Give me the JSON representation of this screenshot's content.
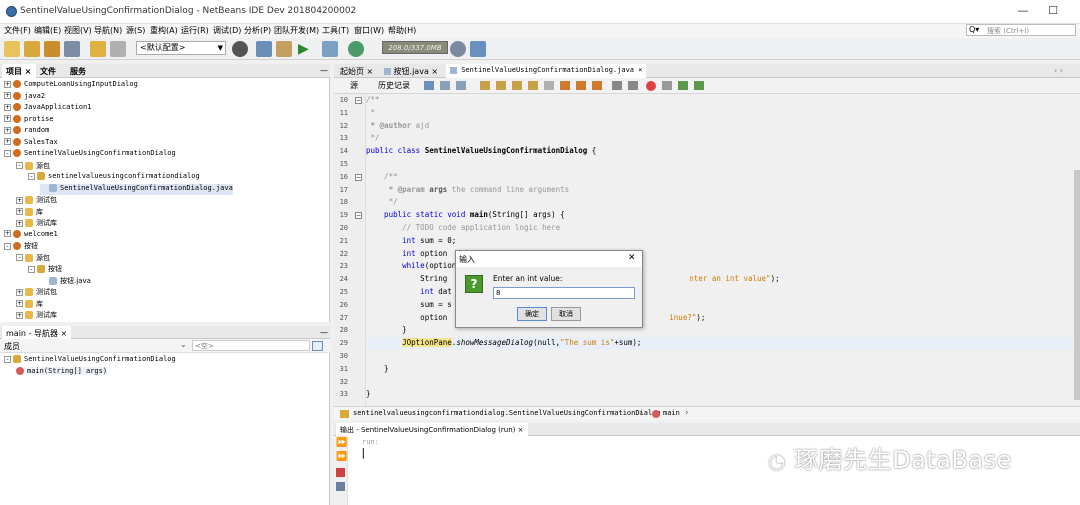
{
  "window": {
    "title": "SentinelValueUsingConfirmationDialog - NetBeans IDE Dev 201804200002",
    "minimize": "—",
    "maximize": "☐"
  },
  "menu": [
    "文件(F)",
    "编辑(E)",
    "视图(V)",
    "导航(N)",
    "源(S)",
    "重构(A)",
    "运行(R)",
    "调试(D)",
    "分析(P)",
    "团队开发(M)",
    "工具(T)",
    "窗口(W)",
    "帮助(H)"
  ],
  "search": {
    "icon": "Q▾",
    "placeholder": "搜索 (Ctrl+I)"
  },
  "toolbar": {
    "config": "<默认配置>",
    "memory": "208.0/337.0MB"
  },
  "project_panel": {
    "tabs": [
      "项目",
      "文件",
      "服务"
    ],
    "close": "×",
    "minimize": "—",
    "tree": [
      {
        "indent": 0,
        "exp": "+",
        "icon": "cup",
        "label": "ComputeLoanUsingInputDialog"
      },
      {
        "indent": 0,
        "exp": "+",
        "icon": "cup",
        "label": "java2"
      },
      {
        "indent": 0,
        "exp": "+",
        "icon": "cup",
        "label": "JavaApplication1"
      },
      {
        "indent": 0,
        "exp": "+",
        "icon": "cup",
        "label": "protise"
      },
      {
        "indent": 0,
        "exp": "+",
        "icon": "cup",
        "label": "random"
      },
      {
        "indent": 0,
        "exp": "+",
        "icon": "cup",
        "label": "SalesTax"
      },
      {
        "indent": 0,
        "exp": "-",
        "icon": "cup",
        "label": "SentinelValueUsingConfirmationDialog"
      },
      {
        "indent": 1,
        "exp": "-",
        "icon": "folder",
        "label": "源包"
      },
      {
        "indent": 2,
        "exp": "-",
        "icon": "pkg",
        "label": "sentinelvalueusingconfirmationdialog"
      },
      {
        "indent": 3,
        "exp": "",
        "icon": "jfile",
        "label": "SentinelValueUsingConfirmationDialog.java",
        "selected": true
      },
      {
        "indent": 1,
        "exp": "+",
        "icon": "folder",
        "label": "测试包"
      },
      {
        "indent": 1,
        "exp": "+",
        "icon": "folder",
        "label": "库"
      },
      {
        "indent": 1,
        "exp": "+",
        "icon": "folder",
        "label": "测试库"
      },
      {
        "indent": 0,
        "exp": "+",
        "icon": "cup",
        "label": "welcome1"
      },
      {
        "indent": 0,
        "exp": "-",
        "icon": "cup",
        "label": "按钮"
      },
      {
        "indent": 1,
        "exp": "-",
        "icon": "folder",
        "label": "源包"
      },
      {
        "indent": 2,
        "exp": "-",
        "icon": "pkg",
        "label": "按钮"
      },
      {
        "indent": 3,
        "exp": "",
        "icon": "jfile",
        "label": "按钮.java"
      },
      {
        "indent": 1,
        "exp": "+",
        "icon": "folder",
        "label": "测试包"
      },
      {
        "indent": 1,
        "exp": "+",
        "icon": "folder",
        "label": "库"
      },
      {
        "indent": 1,
        "exp": "+",
        "icon": "folder",
        "label": "测试库"
      }
    ]
  },
  "navigator": {
    "tab": "main - 导航器",
    "close": "×",
    "minimize": "—",
    "filter_left": "成员",
    "filter_right": "<空>",
    "tree": [
      {
        "indent": 0,
        "exp": "-",
        "label": "SentinelValueUsingConfirmationDialog"
      },
      {
        "indent": 1,
        "exp": "",
        "label": "main(String[] args)"
      }
    ]
  },
  "editor": {
    "tabs": [
      {
        "label": "起始页",
        "active": false
      },
      {
        "label": "按钮.java",
        "active": false
      },
      {
        "label": "SentinelValueUsingConfirmationDialog.java",
        "active": true
      }
    ],
    "close": "×",
    "nav_arrows": "‹ ›",
    "source_tab": "源",
    "history_tab": "历史记录",
    "lines": [
      10,
      11,
      12,
      13,
      14,
      15,
      16,
      17,
      18,
      19,
      20,
      21,
      22,
      23,
      24,
      25,
      26,
      27,
      28,
      29,
      30,
      31,
      32,
      33
    ],
    "breadcrumb": {
      "class": "sentinelvalueusingconfirmationdialog.SentinelValueUsingConfirmationDialog",
      "method": "main"
    }
  },
  "code_text": {
    "l10": "/**",
    "l11": " *",
    "l12_tag": " * @author",
    "l12_val": " ajd",
    "l13": " */",
    "l14_kw": "public class ",
    "l14_name": "SentinelValueUsingConfirmationDialog",
    "l14_end": " {",
    "l16": "    /**",
    "l17_tag": "     * @param",
    "l17_name": " args",
    "l17_rest": " the command line arguments",
    "l18": "     */",
    "l19_kw": "    public static void ",
    "l19_name": "main",
    "l19_rest": "(String[] args) {",
    "l20": "        // TODO code application logic here",
    "l21_kw": "        int",
    "l21_rest": " sum = 0;",
    "l22_kw": "        int",
    "l22_rest": " option",
    "l23_kw": "        while",
    "l23_rest": "(option",
    "l24_a": "            String",
    "l24_str": "nter an int value\"",
    "l24_end": ");",
    "l25_kw": "            int",
    "l25_rest": " dat",
    "l26": "            sum = s",
    "l27_a": "            option",
    "l27_str": "inue?\"",
    "l27_end": ");",
    "l28": "        }",
    "l29_a": "        ",
    "l29_hl": "JOptionPane",
    "l29_b": ".",
    "l29_m": "showMessageDialog",
    "l29_c": "(null,",
    "l29_str": "\"The sum is\"",
    "l29_end": "+sum);",
    "l31": "    }",
    "l33": "}"
  },
  "output": {
    "tab": "输出 - SentinelValueUsingConfirmationDialog (run)",
    "close": "×",
    "run_text": "run:",
    "cursor": "|"
  },
  "dialog": {
    "title": "输入",
    "close": "✕",
    "question_mark": "?",
    "prompt": "Enter an int value:",
    "input_value": "8",
    "ok": "确定",
    "cancel": "取消"
  },
  "watermark": "琢磨先生DataBase",
  "colors": {
    "keyword": "#0000e6",
    "comment": "#969696",
    "string": "#ce7b00",
    "accent": "#3a6ea5"
  }
}
